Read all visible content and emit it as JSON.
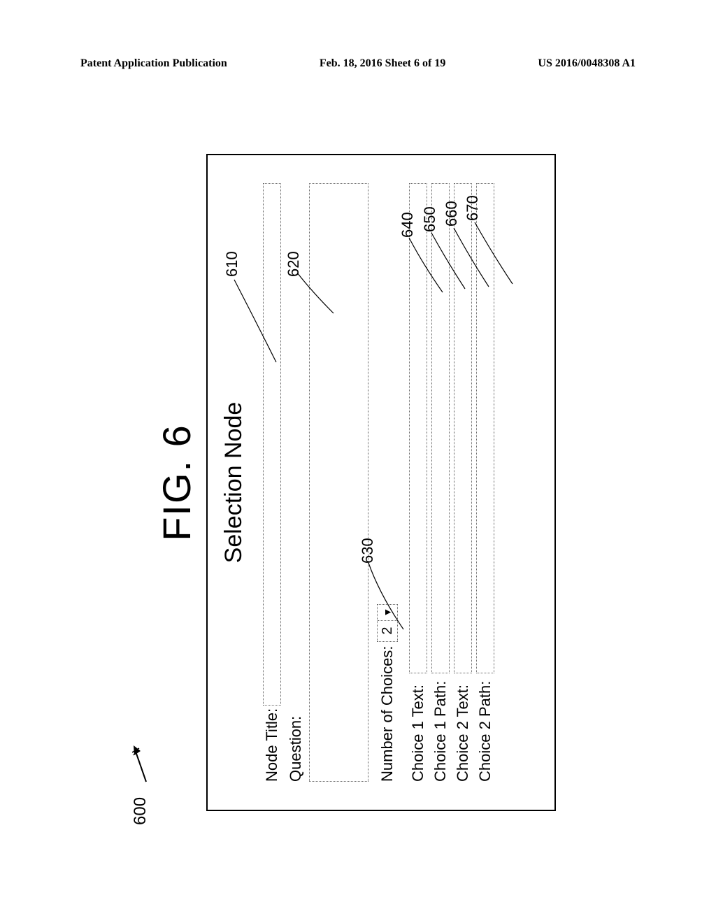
{
  "header": {
    "left": "Patent Application Publication",
    "center": "Feb. 18, 2016  Sheet 6 of 19",
    "right": "US 2016/0048308 A1"
  },
  "figure": {
    "caption": "FIG. 6",
    "ref": "600"
  },
  "panel": {
    "title": "Selection Node",
    "node_title_label": "Node Title:",
    "question_label": "Question:",
    "num_choices_label": "Number of Choices:",
    "num_choices_value": "2",
    "choice1_text_label": "Choice 1 Text:",
    "choice1_path_label": "Choice 1 Path:",
    "choice2_text_label": "Choice 2 Text:",
    "choice2_path_label": "Choice 2 Path:"
  },
  "callouts": {
    "c610": "610",
    "c620": "620",
    "c630": "630",
    "c640": "640",
    "c650": "650",
    "c660": "660",
    "c670": "670"
  }
}
